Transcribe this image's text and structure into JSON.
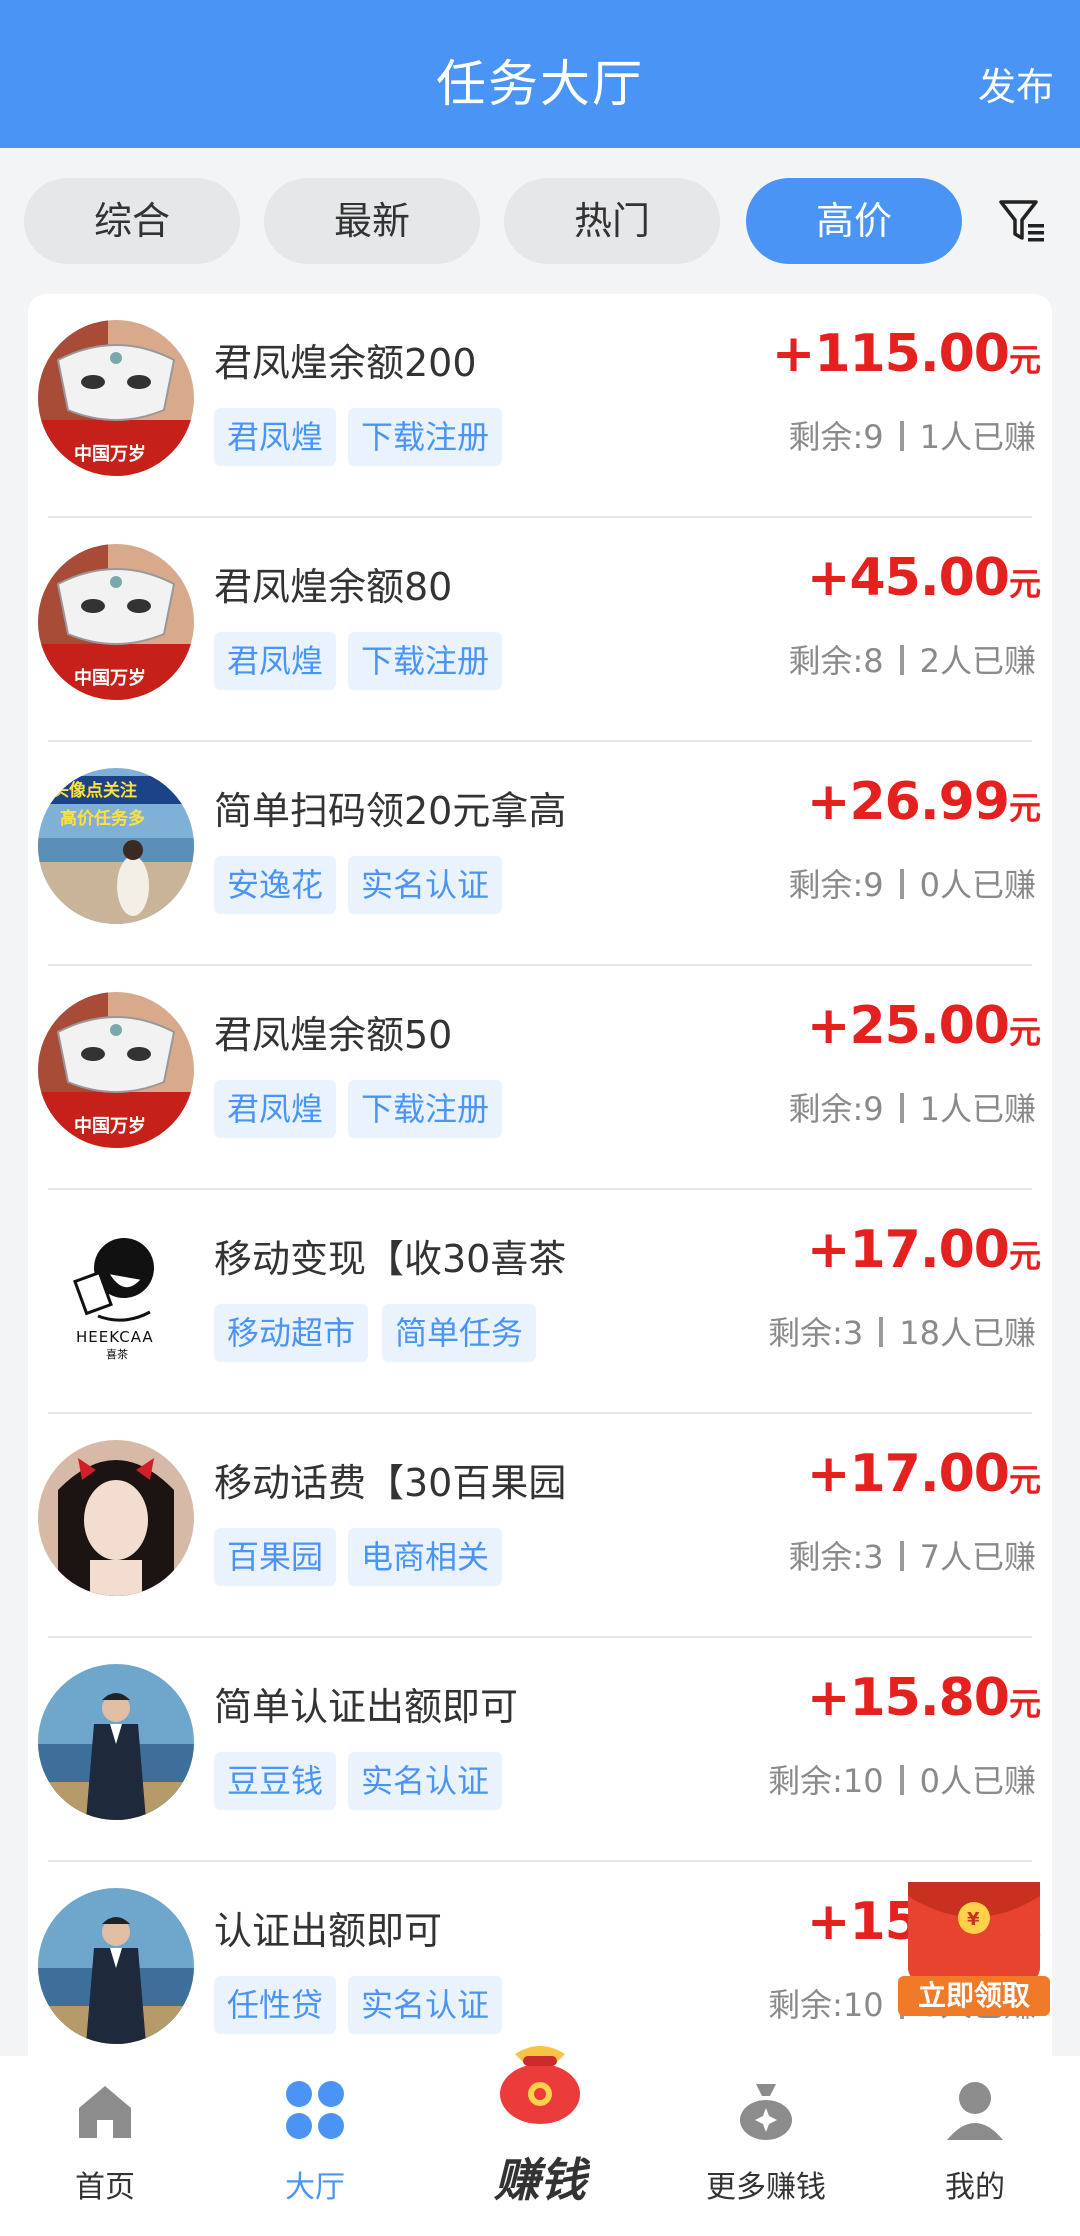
{
  "header": {
    "title": "任务大厅",
    "publish_label": "发布"
  },
  "filters": {
    "tabs": [
      "综合",
      "最新",
      "热门",
      "高价"
    ],
    "active_index": 3
  },
  "tasks": [
    {
      "title": "君凤煌余额200",
      "tags": [
        "君凤煌",
        "下载注册"
      ],
      "price": "+115.00",
      "unit": "元",
      "remaining": "剩余:9",
      "earned": "1人已赚",
      "avatar": "mask-portrait"
    },
    {
      "title": "君凤煌余额80",
      "tags": [
        "君凤煌",
        "下载注册"
      ],
      "price": "+45.00",
      "unit": "元",
      "remaining": "剩余:8",
      "earned": "2人已赚",
      "avatar": "mask-portrait"
    },
    {
      "title": "简单扫码领20元拿高",
      "tags": [
        "安逸花",
        "实名认证"
      ],
      "price": "+26.99",
      "unit": "元",
      "remaining": "剩余:9",
      "earned": "0人已赚",
      "avatar": "beach-portrait",
      "avatar_caption": [
        "头像点关注",
        "高价任务多"
      ]
    },
    {
      "title": "君凤煌余额50",
      "tags": [
        "君凤煌",
        "下载注册"
      ],
      "price": "+25.00",
      "unit": "元",
      "remaining": "剩余:9",
      "earned": "1人已赚",
      "avatar": "mask-portrait"
    },
    {
      "title": "移动变现【收30喜茶",
      "tags": [
        "移动超市",
        "简单任务"
      ],
      "price": "+17.00",
      "unit": "元",
      "remaining": "剩余:3",
      "earned": "18人已赚",
      "avatar": "heekcaa-logo",
      "avatar_caption": [
        "HEEKCAA",
        "喜茶"
      ]
    },
    {
      "title": "移动话费【30百果园",
      "tags": [
        "百果园",
        "电商相关"
      ],
      "price": "+17.00",
      "unit": "元",
      "remaining": "剩余:3",
      "earned": "7人已赚",
      "avatar": "girl-portrait"
    },
    {
      "title": "简单认证出额即可",
      "tags": [
        "豆豆钱",
        "实名认证"
      ],
      "price": "+15.80",
      "unit": "元",
      "remaining": "剩余:10",
      "earned": "0人已赚",
      "avatar": "man-portrait"
    },
    {
      "title": "认证出额即可",
      "tags": [
        "任性贷",
        "实名认证"
      ],
      "price": "+15.80",
      "unit": "元",
      "remaining": "剩余:10",
      "earned": "0人已赚",
      "avatar": "man-portrait"
    }
  ],
  "mask_caption": "中国万岁",
  "floating_badge": {
    "label": "立即领取"
  },
  "tabbar": {
    "items": [
      {
        "label": "首页",
        "icon": "home-icon"
      },
      {
        "label": "大厅",
        "icon": "grid-icon"
      },
      {
        "label": "赚钱",
        "icon": "money-bag-icon"
      },
      {
        "label": "更多赚钱",
        "icon": "coin-bag-icon"
      },
      {
        "label": "我的",
        "icon": "user-icon"
      }
    ],
    "active_index": 1
  },
  "colors": {
    "primary": "#4a94f5",
    "price": "#e5211f",
    "tag_bg": "#eaf3fd"
  }
}
